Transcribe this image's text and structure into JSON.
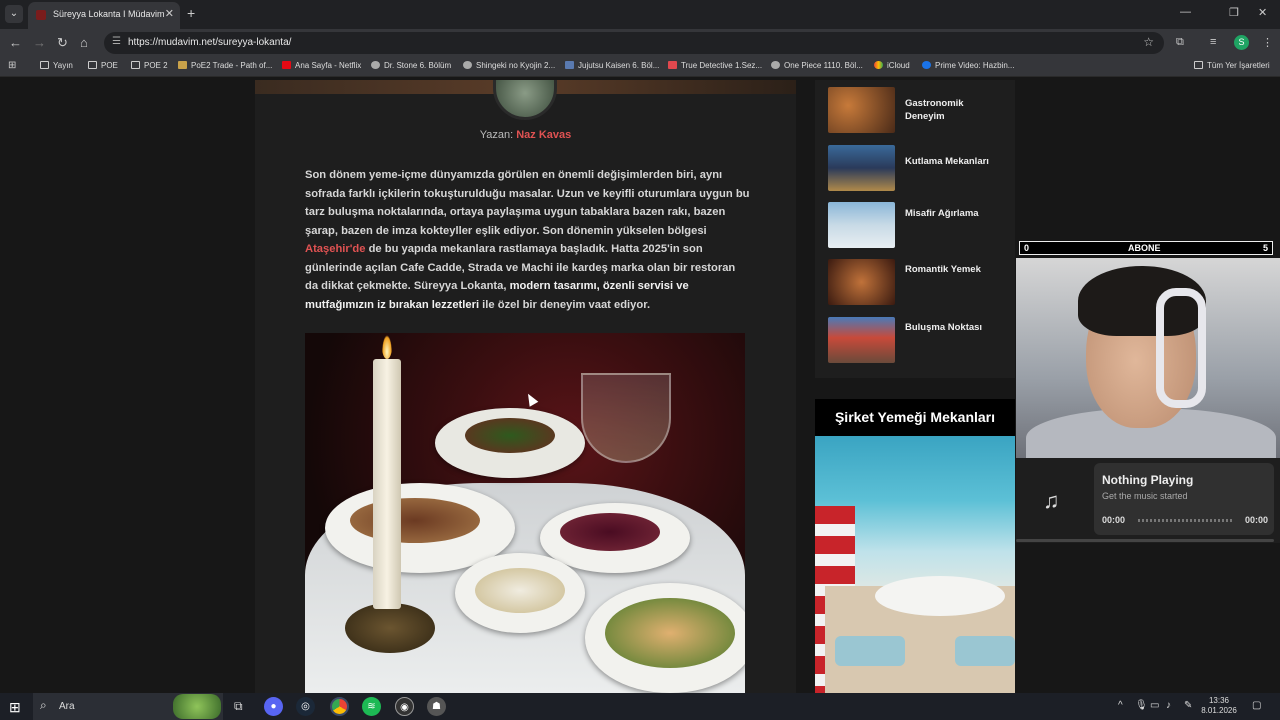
{
  "browser": {
    "tab_title": "Süreyya Lokanta I Müdavim",
    "url": "https://mudavim.net/sureyya-lokanta/",
    "profile_initial": "S"
  },
  "bookmarks": {
    "items": [
      "Yayın",
      "POE",
      "POE 2",
      "PoE2 Trade - Path of...",
      "Ana Sayfa - Netflix",
      "Dr. Stone 6. Bölüm",
      "Shingeki no Kyojin 2...",
      "Jujutsu Kaisen 6. Böl...",
      "True Detective 1.Sez...",
      "One Piece 1110. Böl...",
      "iCloud",
      "Prime Video: Hazbin..."
    ],
    "all": "Tüm Yer İşaretleri"
  },
  "article": {
    "author_prefix": "Yazan:",
    "author_name": "Naz Kavas",
    "p1": "Son dönem yeme-içme dünyamızda görülen en önemli değişimlerden biri, aynı sofrada farklı içkilerin tokuşturulduğu masalar. Uzun ve keyifli oturumlara uygun bu tarz buluşma noktalarında, ortaya paylaşıma uygun tabaklara bazen rakı, bazen şarap, bazen de imza kokteyller eşlik ediyor. Son dönemin yükselen bölgesi ",
    "p1_link": "Ataşehir'de",
    "p2": " de bu yapıda mekanlara rastlamaya başladık. Hatta 2025'in son günlerinde açılan Cafe Cadde, Strada ve Machi ile kardeş marka olan bir restoran da dikkat çekmekte. Süreyya Lokanta, ",
    "p2_strong": "modern tasarımı, özenli servisi ve mutfağımızın iz bırakan lezzetleri",
    "p3": " ile özel bir deneyim vaat ediyor."
  },
  "sidebar": {
    "items": [
      {
        "label": "Gastronomik Deneyim"
      },
      {
        "label": "Kutlama Mekanları"
      },
      {
        "label": "Misafir Ağırlama"
      },
      {
        "label": "Romantik Yemek"
      },
      {
        "label": "Buluşma Noktası"
      }
    ],
    "widget_title": "Şirket Yemeği Mekanları"
  },
  "overlay": {
    "sub_left": "0",
    "sub_label": "ABONE",
    "sub_right": "5",
    "music_title": "Nothing Playing",
    "music_sub": "Get the music started",
    "time_start": "00:00",
    "time_end": "00:00"
  },
  "taskbar": {
    "search_placeholder": "Ara",
    "time": "13:36",
    "date": "8.01.2026"
  }
}
